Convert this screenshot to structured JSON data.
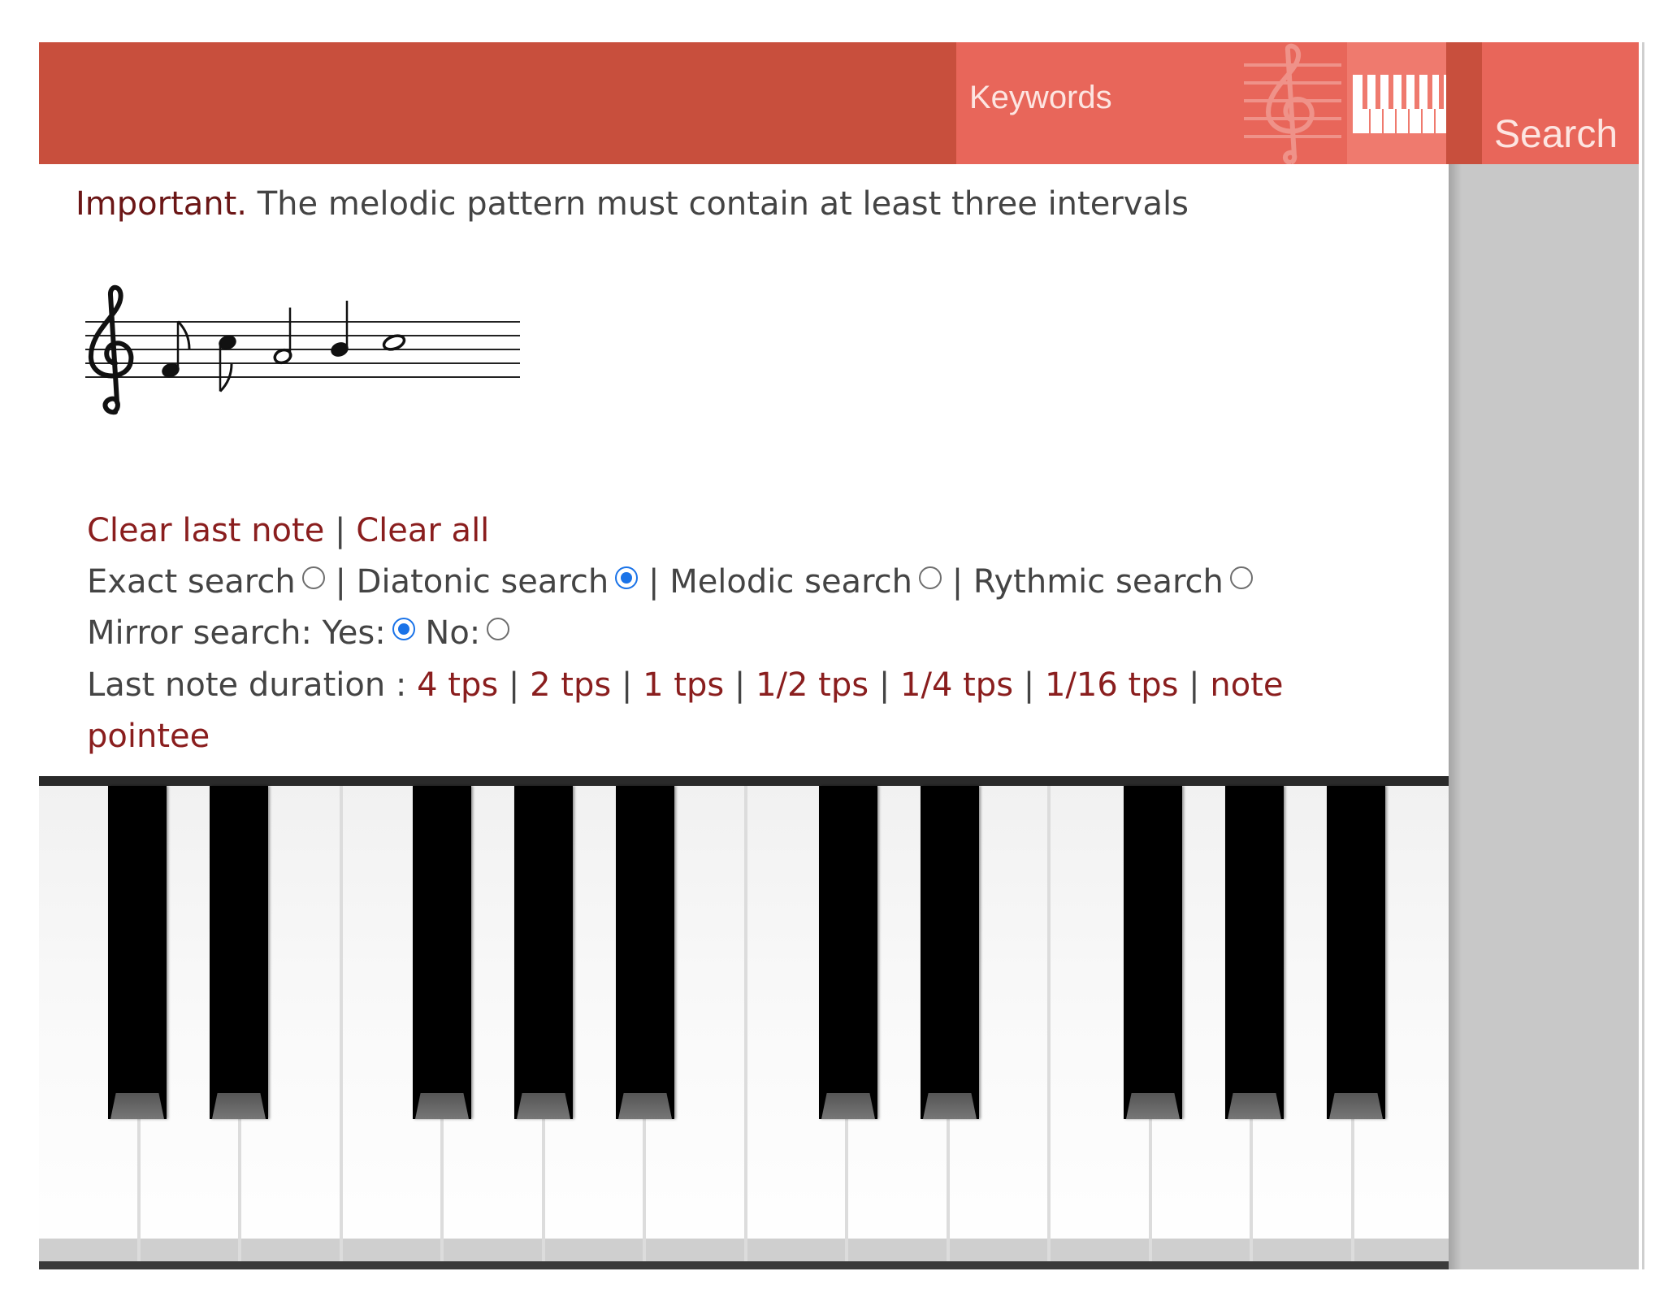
{
  "header": {
    "keywords_label": "Keywords",
    "search_label": "Search",
    "colors": {
      "bar": "#c84f3d",
      "active": "#e8665a",
      "tab": "#ef7a6e"
    },
    "icons": [
      "treble-clef-icon",
      "piano-keys-icon"
    ]
  },
  "notice": {
    "strong": "Important.",
    "text": " The melodic pattern must contain at least three intervals"
  },
  "staff": {
    "clef": "treble",
    "notes": [
      {
        "pitch": "F4",
        "duration": "eighth"
      },
      {
        "pitch": "C5",
        "duration": "eighth"
      },
      {
        "pitch": "A4",
        "duration": "half"
      },
      {
        "pitch": "B4",
        "duration": "quarter"
      },
      {
        "pitch": "C5",
        "duration": "whole"
      }
    ]
  },
  "controls": {
    "clear_last": "Clear last note",
    "separator": "|",
    "clear_all": "Clear all",
    "search_modes": [
      {
        "label": "Exact search",
        "checked": false
      },
      {
        "label": "Diatonic search",
        "checked": true
      },
      {
        "label": "Melodic search",
        "checked": false
      },
      {
        "label": "Rythmic search",
        "checked": false
      }
    ],
    "mirror": {
      "label": "Mirror search: Yes:",
      "no_label": "No:",
      "yes_checked": true,
      "no_checked": false
    },
    "duration": {
      "label": "Last note duration : ",
      "options": [
        "4 tps",
        "2 tps",
        "1 tps",
        "1/2 tps",
        "1/4 tps",
        "1/16 tps",
        "note",
        "pointee"
      ]
    }
  },
  "piano": {
    "white_keys": 14,
    "black_keys": 10
  }
}
